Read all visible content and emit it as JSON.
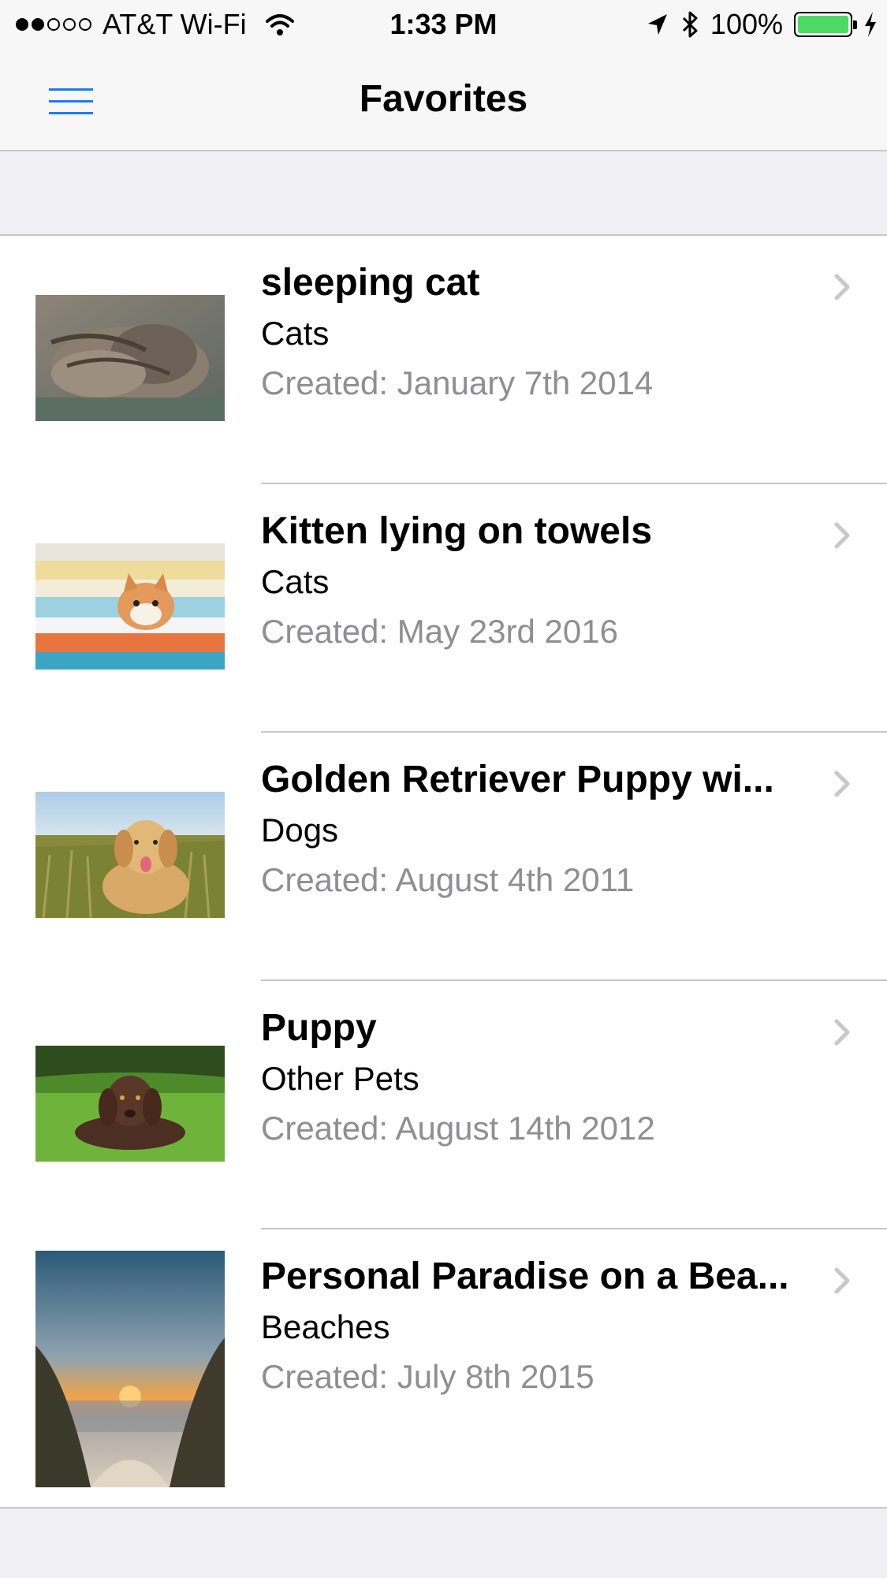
{
  "status_bar": {
    "carrier": "AT&T Wi-Fi",
    "time": "1:33 PM",
    "battery": "100%"
  },
  "nav": {
    "title": "Favorites"
  },
  "items": [
    {
      "title": "sleeping cat",
      "category": "Cats",
      "date": "Created: January 7th 2014"
    },
    {
      "title": "Kitten lying on towels",
      "category": "Cats",
      "date": "Created: May 23rd 2016"
    },
    {
      "title": "Golden Retriever Puppy wi...",
      "category": "Dogs",
      "date": "Created: August 4th 2011"
    },
    {
      "title": "Puppy",
      "category": "Other Pets",
      "date": "Created: August 14th 2012"
    },
    {
      "title": "Personal Paradise on a Bea...",
      "category": "Beaches",
      "date": "Created: July 8th 2015"
    }
  ]
}
